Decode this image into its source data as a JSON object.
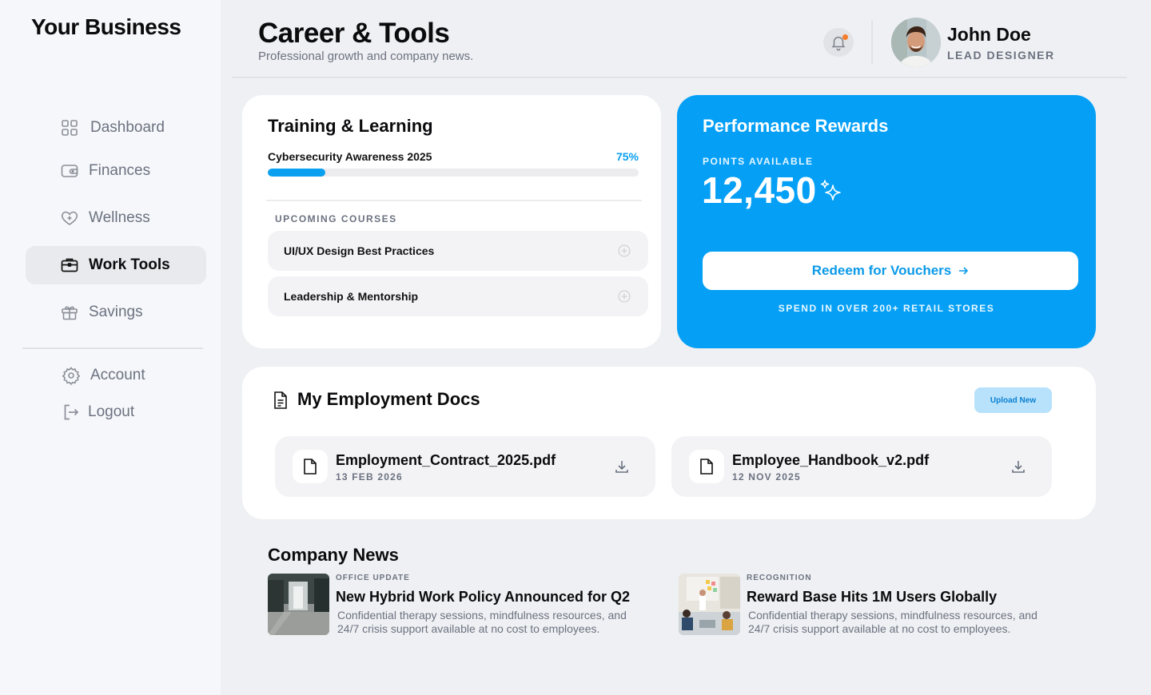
{
  "brand": "Your Business",
  "nav": {
    "items": [
      {
        "label": "Dashboard",
        "icon": "grid-icon"
      },
      {
        "label": "Finances",
        "icon": "wallet-icon"
      },
      {
        "label": "Wellness",
        "icon": "heart-icon"
      },
      {
        "label": "Work Tools",
        "icon": "briefcase-icon",
        "active": true
      },
      {
        "label": "Savings",
        "icon": "gift-icon"
      }
    ],
    "account": {
      "label": "Account",
      "icon": "gear-icon"
    },
    "logout": {
      "label": "Logout",
      "icon": "logout-icon"
    }
  },
  "header": {
    "title": "Career & Tools",
    "subtitle": "Professional growth and company news.",
    "user": {
      "name": "John Doe",
      "role": "LEAD DESIGNER"
    }
  },
  "training": {
    "title": "Training & Learning",
    "current_course": "Cybersecurity Awareness 2025",
    "progress_label": "75%",
    "progress": 0.155,
    "section_caption": "UPCOMING COURSES",
    "courses": [
      "UI/UX Design Best Practices",
      "Leadership & Mentorship"
    ]
  },
  "rewards": {
    "title": "Performance Rewards",
    "points_caption": "POINTS AVAILABLE",
    "points": "12,450",
    "redeem_label": "Redeem for Vouchers",
    "footnote": "SPEND IN OVER 200+ RETAIL STORES"
  },
  "docs": {
    "title": "My Employment Docs",
    "upload_label": "Upload New",
    "files": [
      {
        "name": "Employment_Contract_2025.pdf",
        "date": "13 FEB 2026"
      },
      {
        "name": "Employee_Handbook_v2.pdf",
        "date": "12 NOV 2025"
      }
    ]
  },
  "news": {
    "title": "Company News",
    "items": [
      {
        "category": "OFFICE UPDATE",
        "title": "New Hybrid Work Policy Announced for Q2",
        "description": "Confidential therapy sessions, mindfulness resources, and 24/7 crisis support available at no cost to employees."
      },
      {
        "category": "RECOGNITION",
        "title": "Reward Base Hits 1M Users Globally",
        "description": "Confidential therapy sessions, mindfulness resources, and 24/7 crisis support available at no cost to employees."
      }
    ]
  },
  "colors": {
    "accent": "#05a0f6",
    "notification_dot": "#f57c2a"
  }
}
